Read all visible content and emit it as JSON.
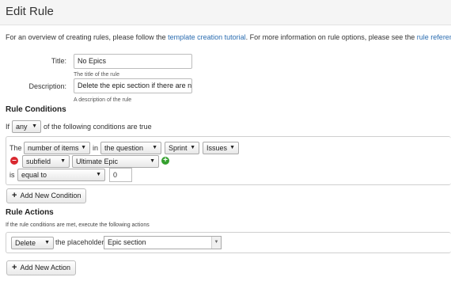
{
  "header": {
    "title": "Edit Rule"
  },
  "intro": {
    "text_before": "For an overview of creating rules, please follow the ",
    "link1": "template creation tutorial",
    "text_middle": ". For more information on rule options, please see the ",
    "link2": "rule reference",
    "text_after": "."
  },
  "form": {
    "title_label": "Title:",
    "title_value": "No Epics",
    "title_hint": "The title of the rule",
    "desc_label": "Description:",
    "desc_value": "Delete the epic section if there are no",
    "desc_hint": "A description of the rule"
  },
  "conditions": {
    "heading": "Rule Conditions",
    "if_label": "If",
    "match_select": "any",
    "match_suffix": "of the following conditions are true",
    "row1": {
      "the_label": "The",
      "measure_select": "number of items",
      "in_label": "in",
      "scope_select": "the question",
      "source_select": "Sprint",
      "type_select": "Issues"
    },
    "row2": {
      "field_select": "subfield",
      "value_select": "Ultimate Epic"
    },
    "row3": {
      "is_label": "is",
      "operator_select": "equal to",
      "value": "0"
    },
    "add_button": "Add New Condition"
  },
  "actions": {
    "heading": "Rule Actions",
    "subtitle": "If the rule conditions are met, execute the following actions",
    "action_select": "Delete",
    "placeholder_label": "the placeholder",
    "placeholder_value": "Epic section",
    "add_button": "Add New Action"
  },
  "colors": {
    "link": "#2a6cb0",
    "remove": "#d9282f",
    "add": "#35a02f"
  }
}
